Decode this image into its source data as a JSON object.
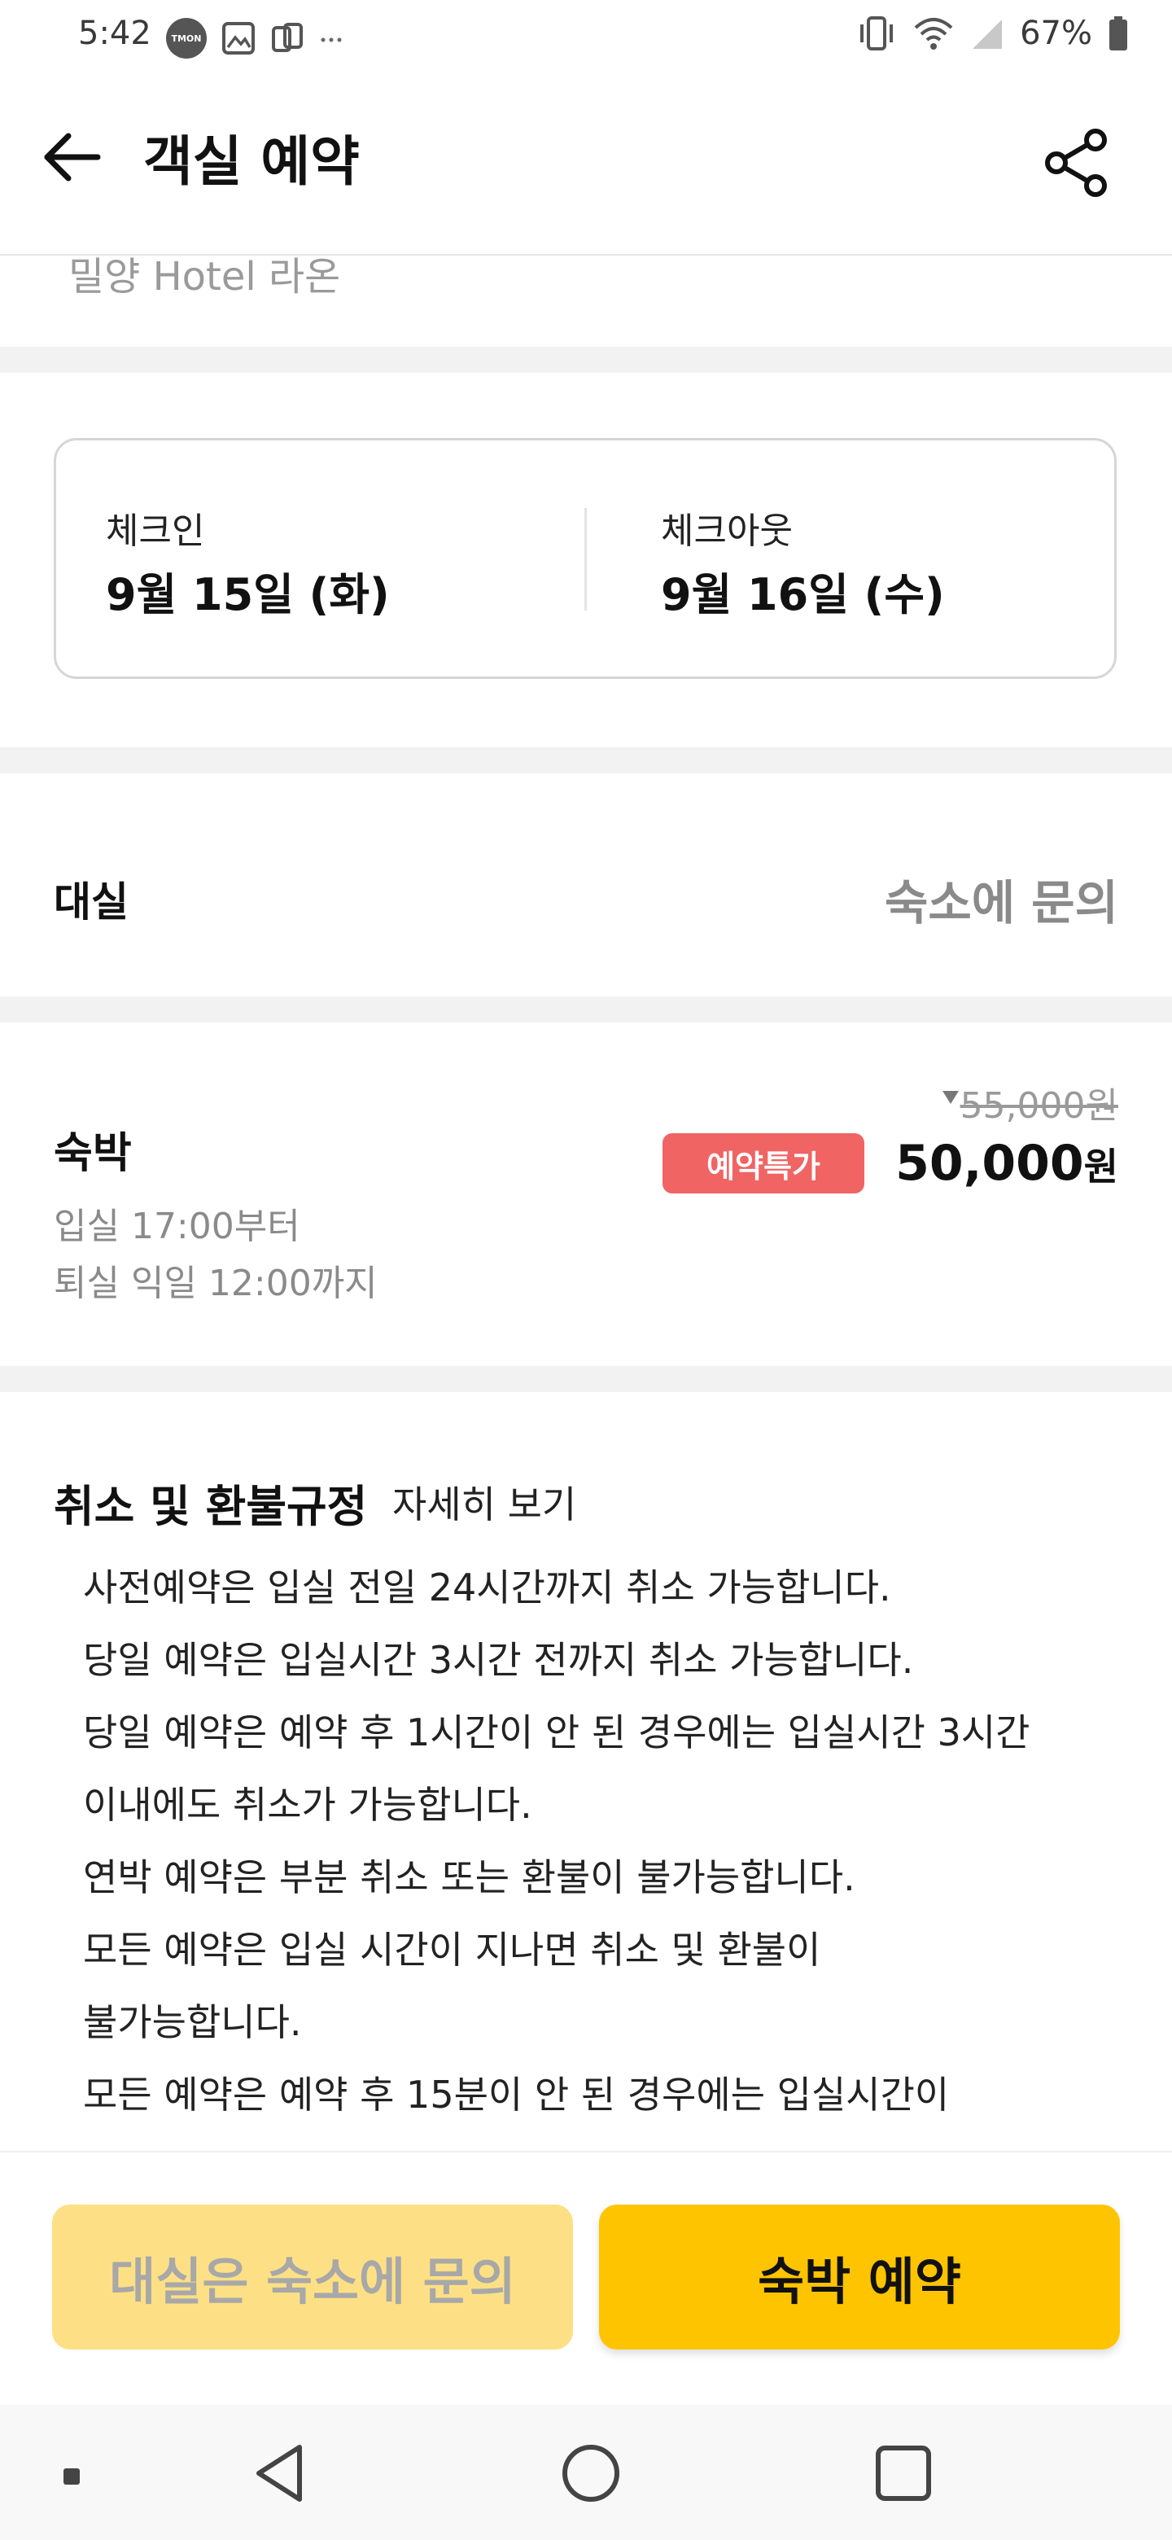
{
  "status_bar": {
    "time": "5:42",
    "tmon_badge": "TMON",
    "battery": "67%",
    "icons": [
      "tmon-icon",
      "gallery-icon",
      "screen-mirror-icon",
      "more-icon",
      "vibrate-icon",
      "wifi-icon",
      "signal-icon",
      "battery-icon"
    ]
  },
  "header": {
    "title": "객실 예약",
    "back_icon": "back-arrow-icon",
    "share_icon": "share-icon"
  },
  "hotel": {
    "name": "밀양 Hotel 라온"
  },
  "dates": {
    "checkin_label": "체크인",
    "checkin_value": "9월 15일 (화)",
    "checkout_label": "체크아웃",
    "checkout_value": "9월 16일 (수)"
  },
  "rent": {
    "label": "대실",
    "value": "숙소에 문의"
  },
  "stay": {
    "title": "숙박",
    "checkin_time": "입실 17:00부터",
    "checkout_time": "퇴실 익일 12:00까지",
    "badge": "예약특가",
    "original_price": "55,000원",
    "sale_amount": "50,000",
    "sale_unit": "원"
  },
  "policy": {
    "title": "취소 및 환불규정",
    "detail_link": "자세히 보기",
    "lines": [
      "사전예약은 입실 전일 24시간까지 취소 가능합니다.",
      "당일 예약은 입실시간 3시간 전까지 취소 가능합니다.",
      "당일 예약은 예약 후 1시간이 안 된 경우에는 입실시간 3시간",
      "이내에도 취소가 가능합니다.",
      "연박 예약은 부분 취소 또는 환불이 불가능합니다.",
      "모든 예약은 입실 시간이 지나면 취소 및 환불이",
      "불가능합니다.",
      "모든 예약은 예약 후 15분이 안 된 경우에는 입실시간이"
    ]
  },
  "actions": {
    "rent_button": "대실은 숙소에 문의",
    "stay_button": "숙박 예약"
  },
  "nav_bar": {
    "icons": [
      "recent-dot-icon",
      "back-triangle-icon",
      "home-circle-icon",
      "overview-square-icon"
    ]
  },
  "colors": {
    "accent": "#ffc400",
    "accent_disabled": "#fde085",
    "badge": "#f06464",
    "separator": "#f2f2f2"
  }
}
